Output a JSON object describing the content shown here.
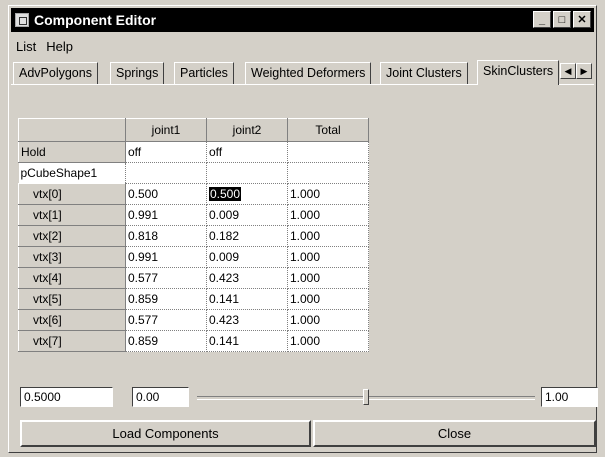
{
  "window": {
    "title": "Component Editor"
  },
  "menu": [
    "List",
    "Help"
  ],
  "tabs": [
    "AdvPolygons",
    "Springs",
    "Particles",
    "Weighted Deformers",
    "Joint Clusters",
    "SkinClusters"
  ],
  "table": {
    "columns": [
      "joint1",
      "joint2",
      "Total"
    ],
    "hold": {
      "label": "Hold",
      "values": [
        "off",
        "off",
        ""
      ]
    },
    "shape": "pCubeShape1",
    "rows": [
      {
        "label": "vtx[0]",
        "values": [
          "0.500",
          "0.500",
          "1.000"
        ]
      },
      {
        "label": "vtx[1]",
        "values": [
          "0.991",
          "0.009",
          "1.000"
        ]
      },
      {
        "label": "vtx[2]",
        "values": [
          "0.818",
          "0.182",
          "1.000"
        ]
      },
      {
        "label": "vtx[3]",
        "values": [
          "0.991",
          "0.009",
          "1.000"
        ]
      },
      {
        "label": "vtx[4]",
        "values": [
          "0.577",
          "0.423",
          "1.000"
        ]
      },
      {
        "label": "vtx[5]",
        "values": [
          "0.859",
          "0.141",
          "1.000"
        ]
      },
      {
        "label": "vtx[6]",
        "values": [
          "0.577",
          "0.423",
          "1.000"
        ]
      },
      {
        "label": "vtx[7]",
        "values": [
          "0.859",
          "0.141",
          "1.000"
        ]
      }
    ],
    "selected_cell": {
      "row": 0,
      "col": 1
    }
  },
  "controls": {
    "value_field": "0.5000",
    "min_field": "0.00",
    "max_field": "1.00",
    "slider_fraction": 0.5
  },
  "buttons": {
    "load": "Load Components",
    "close": "Close"
  },
  "icons": {
    "app": "component-editor-icon",
    "minimize": "minimize-icon",
    "maximize": "maximize-icon",
    "close": "close-icon",
    "left": "arrow-left-icon",
    "right": "arrow-right-icon"
  }
}
